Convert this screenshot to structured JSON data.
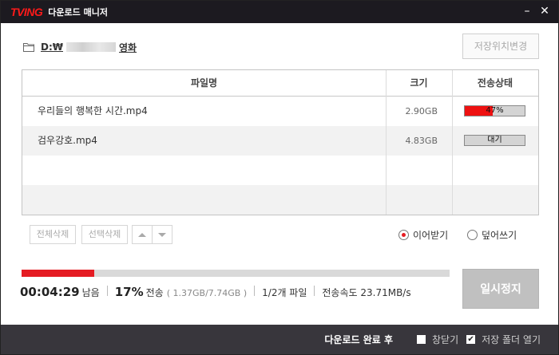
{
  "app": {
    "logo": "TVING",
    "title": "다운로드 매니저",
    "minimize_glyph": "–",
    "close_glyph": "✕"
  },
  "path": {
    "prefix": "D:₩",
    "suffix": "영화",
    "change_button": "저장위치변경"
  },
  "table": {
    "headers": {
      "name": "파일명",
      "size": "크기",
      "status": "전송상태"
    },
    "rows": [
      {
        "name": "우리들의 행복한 시간.mp4",
        "size": "2.90GB",
        "status": "47%",
        "progress": 0.47
      },
      {
        "name": "검우강호.mp4",
        "size": "4.83GB",
        "status": "대기",
        "progress": 0
      }
    ]
  },
  "actions": {
    "delete_all": "전체삭제",
    "delete_selected": "선택삭제"
  },
  "options": {
    "resume": "이어받기",
    "overwrite": "덮어쓰기",
    "selected": "resume"
  },
  "transfer": {
    "time_remaining": "00:04:29",
    "remaining_label": "남음",
    "percent": "17%",
    "percent_label": "전송",
    "bytes": "( 1.37GB/7.74GB )",
    "files": "1/2개 파일",
    "speed": "전송속도 23.71MB/s",
    "overall_progress": 0.17,
    "pause_button": "일시정지"
  },
  "footer": {
    "label": "다운로드 완료 후",
    "close_option": "창닫기",
    "close_checked": false,
    "open_folder_option": "저장 폴더 열기",
    "open_folder_checked": true
  },
  "colors": {
    "accent": "#e51c23",
    "titlebar": "#1c1a20",
    "footer": "#38363c"
  }
}
